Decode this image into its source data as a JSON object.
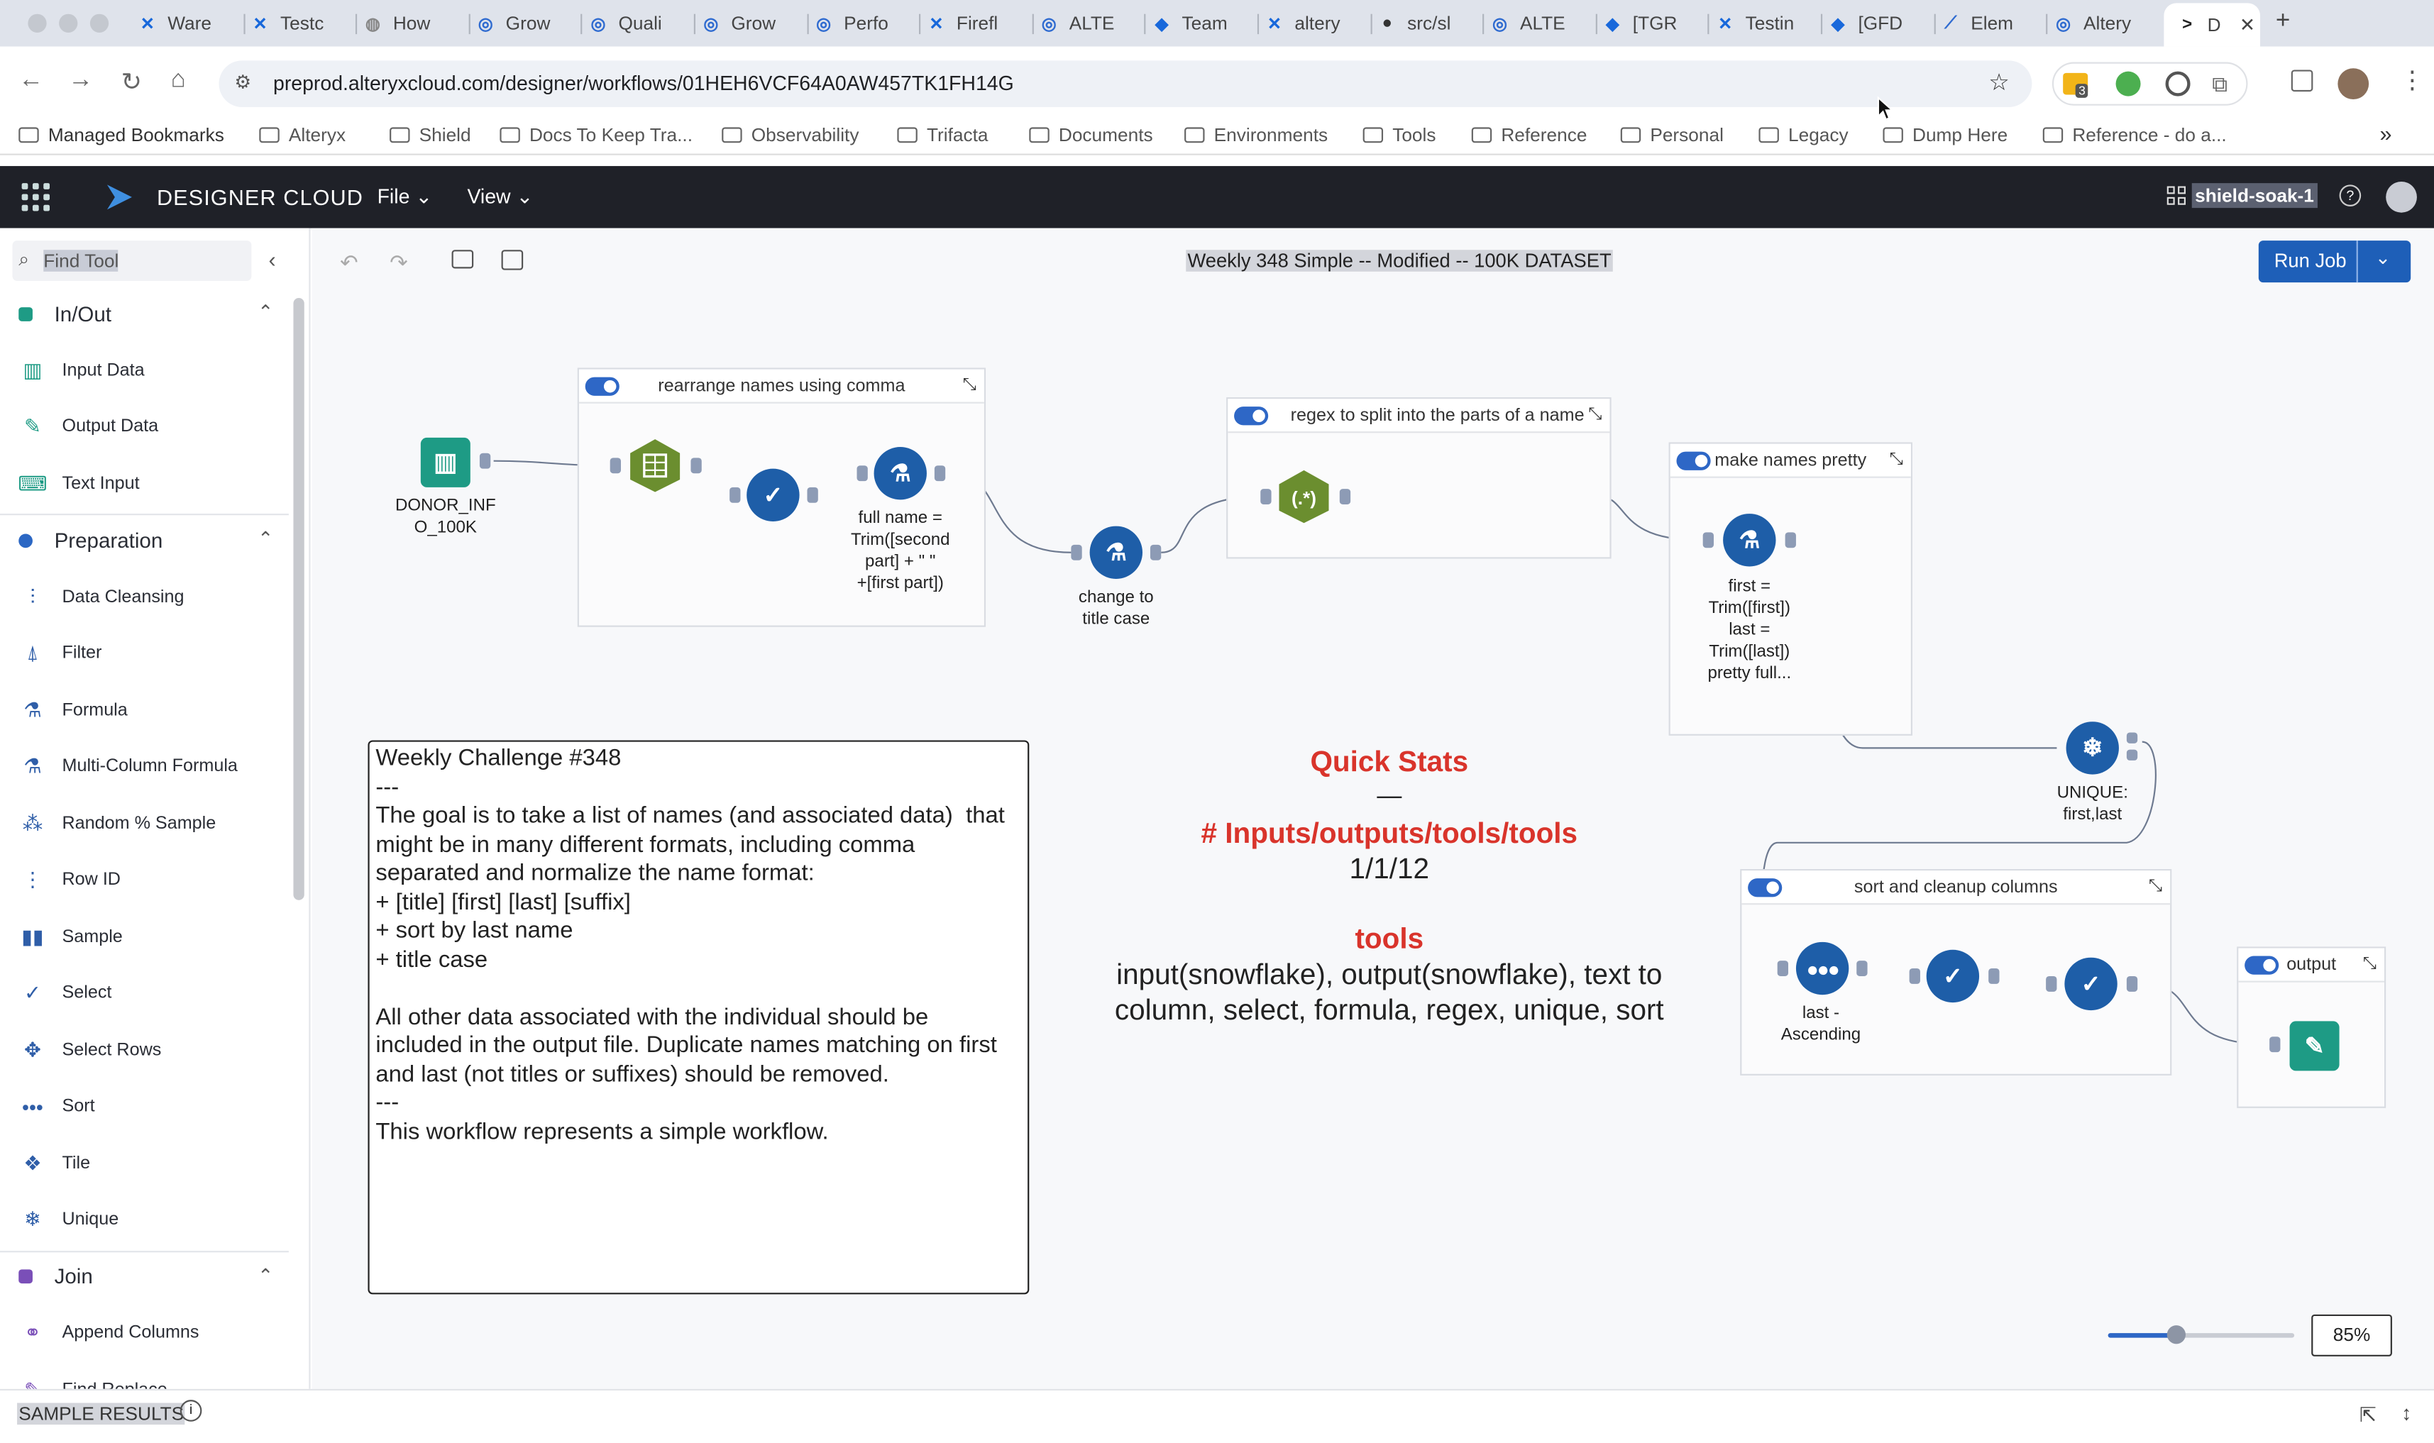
{
  "browser": {
    "tabs": [
      {
        "label": "Ware",
        "icon": "confluence-icon"
      },
      {
        "label": "Testc",
        "icon": "confluence-icon"
      },
      {
        "label": "How",
        "icon": "generic-page-icon"
      },
      {
        "label": "Grow",
        "icon": "alteryx-icon"
      },
      {
        "label": "Quali",
        "icon": "alteryx-icon"
      },
      {
        "label": "Grow",
        "icon": "alteryx-icon"
      },
      {
        "label": "Perfo",
        "icon": "alteryx-icon"
      },
      {
        "label": "Firefl",
        "icon": "confluence-icon"
      },
      {
        "label": "ALTE",
        "icon": "alteryx-icon"
      },
      {
        "label": "Team",
        "icon": "jira-icon"
      },
      {
        "label": "altery",
        "icon": "confluence-icon"
      },
      {
        "label": "src/sl",
        "icon": "github-icon"
      },
      {
        "label": "ALTE",
        "icon": "alteryx-icon"
      },
      {
        "label": "[TGR",
        "icon": "jira-icon"
      },
      {
        "label": "Testin",
        "icon": "confluence-icon"
      },
      {
        "label": "[GFD",
        "icon": "jira-icon"
      },
      {
        "label": "Elem",
        "icon": "chart-icon"
      },
      {
        "label": "Altery",
        "icon": "alteryx-icon"
      }
    ],
    "active_tab": {
      "label": "D"
    },
    "url": "preprod.alteryxcloud.com/designer/workflows/01HEH6VCF64A0AW457TK1FH14G",
    "extension_badge": "3",
    "bookmarks": [
      {
        "label": "Managed Bookmarks"
      },
      {
        "label": "Alteryx"
      },
      {
        "label": "Shield"
      },
      {
        "label": "Docs To Keep Tra..."
      },
      {
        "label": "Observability"
      },
      {
        "label": "Trifacta"
      },
      {
        "label": "Documents"
      },
      {
        "label": "Environments"
      },
      {
        "label": "Tools"
      },
      {
        "label": "Reference"
      },
      {
        "label": "Personal"
      },
      {
        "label": "Legacy"
      },
      {
        "label": "Dump Here"
      },
      {
        "label": "Reference - do a..."
      }
    ]
  },
  "app": {
    "brand": "DESIGNER CLOUD",
    "menu_file": "File",
    "menu_view": "View",
    "workspace": "shield-soak-1"
  },
  "sidebar": {
    "search_placeholder": "Find Tool",
    "categories": [
      {
        "label": "In/Out",
        "color": "#1e9b85"
      },
      {
        "label": "Preparation",
        "color": "#2b67c4"
      },
      {
        "label": "Join",
        "color": "#7a4fb8"
      }
    ],
    "inout_tools": [
      "Input Data",
      "Output Data",
      "Text Input"
    ],
    "prep_tools": [
      "Data Cleansing",
      "Filter",
      "Formula",
      "Multi-Column Formula",
      "Random % Sample",
      "Row ID",
      "Sample",
      "Select",
      "Select Rows",
      "Sort",
      "Tile",
      "Unique"
    ],
    "join_tools": [
      "Append Columns",
      "Find Replace"
    ]
  },
  "canvas": {
    "workflow_title": "Weekly 348 Simple -- Modified -- 100K DATASET",
    "run_job": "Run Job",
    "containers": [
      {
        "title": "rearrange names using comma"
      },
      {
        "title": "regex to split into the parts of a name"
      },
      {
        "title": "make names pretty"
      },
      {
        "title": "sort and cleanup columns"
      },
      {
        "title": "output"
      }
    ],
    "labels": {
      "input": "DONOR_INFO_100K",
      "formula1": "full name =\nTrim([second\npart] + \" \"\n+[first part])",
      "titlecase": "change to\ntitle case",
      "regex_symbol": "(.*)",
      "formula2": "first =\nTrim([first])\nlast =\nTrim([last])\npretty full...",
      "unique": "UNIQUE:\nfirst,last",
      "sort": "last -\nAscending"
    },
    "comment": "Weekly Challenge #348\n---\nThe goal is to take a list of names (and associated data)  that might be in many different formats, including comma separated and normalize the name format:\n+ [title] [first] [last] [suffix]\n+ sort by last name\n+ title case\n\nAll other data associated with the individual should be included in the output file. Duplicate names matching on first and last (not titles or suffixes) should be removed.\n---\nThis workflow represents a simple workflow.",
    "stats": {
      "heading": "Quick Stats",
      "dash": "—",
      "sub1": "# Inputs/outputs/tools/tools",
      "value1": "1/1/12",
      "sub2": "tools",
      "tools_list": "input(snowflake), output(snowflake), text to column, select, formula, regex, unique, sort",
      "accent": "#d9342b"
    },
    "zoom": "85%"
  },
  "bottom": {
    "label": "SAMPLE RESULTS"
  }
}
